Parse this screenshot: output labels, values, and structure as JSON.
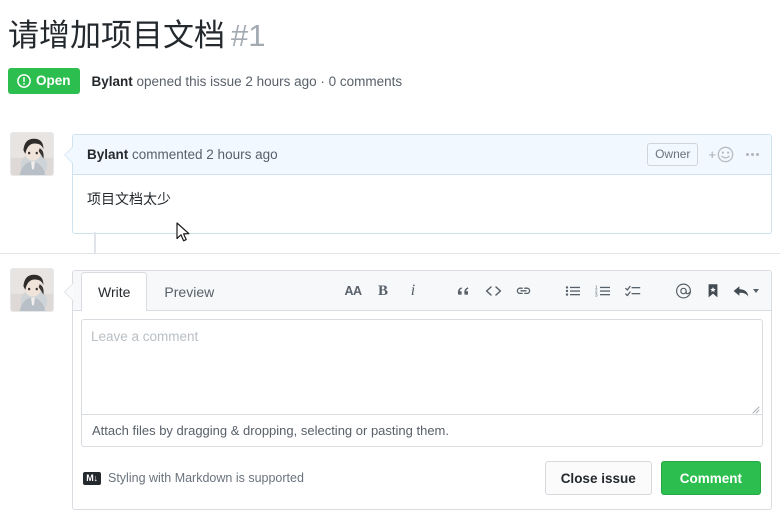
{
  "issue": {
    "title": "请增加项目文档",
    "number": "#1",
    "state_label": "Open",
    "state_icon": "issue-opened-icon",
    "state_color": "#2cbe4e",
    "meta_author": "Bylant",
    "meta_text": " opened this issue 2 hours ago · 0 comments"
  },
  "comment": {
    "author": "Bylant",
    "action_text": " commented 2 hours ago",
    "body": "项目文档太少",
    "owner_badge": "Owner",
    "react_icon": "add-reaction-icon",
    "menu_icon": "kebab-menu-icon",
    "avatar_alt": "Bylant avatar"
  },
  "form": {
    "tabs": [
      {
        "label": "Write",
        "active": true
      },
      {
        "label": "Preview",
        "active": false
      }
    ],
    "toolbar": [
      {
        "name": "heading-icon",
        "glyph": "AA"
      },
      {
        "name": "bold-icon",
        "glyph": "B"
      },
      {
        "name": "italic-icon",
        "glyph": "i"
      },
      {
        "name": "quote-icon",
        "glyph": "“"
      },
      {
        "name": "code-icon",
        "glyph": "<>"
      },
      {
        "name": "link-icon",
        "glyph": "link"
      },
      {
        "name": "unordered-list-icon",
        "glyph": "list"
      },
      {
        "name": "ordered-list-icon",
        "glyph": "numlist"
      },
      {
        "name": "task-list-icon",
        "glyph": "tasklist"
      },
      {
        "name": "mention-icon",
        "glyph": "@"
      },
      {
        "name": "saved-replies-icon",
        "glyph": "bookmark"
      },
      {
        "name": "reply-icon",
        "glyph": "reply"
      }
    ],
    "textarea_placeholder": "Leave a comment",
    "textarea_value": "",
    "attach_hint": "Attach files by dragging & dropping, selecting or pasting them.",
    "markdown_note": "Styling with Markdown is supported",
    "markdown_badge": "M↓",
    "close_button": "Close issue",
    "comment_button": "Comment",
    "comment_button_color": "#2cbe4e",
    "avatar_alt": "Your avatar"
  }
}
